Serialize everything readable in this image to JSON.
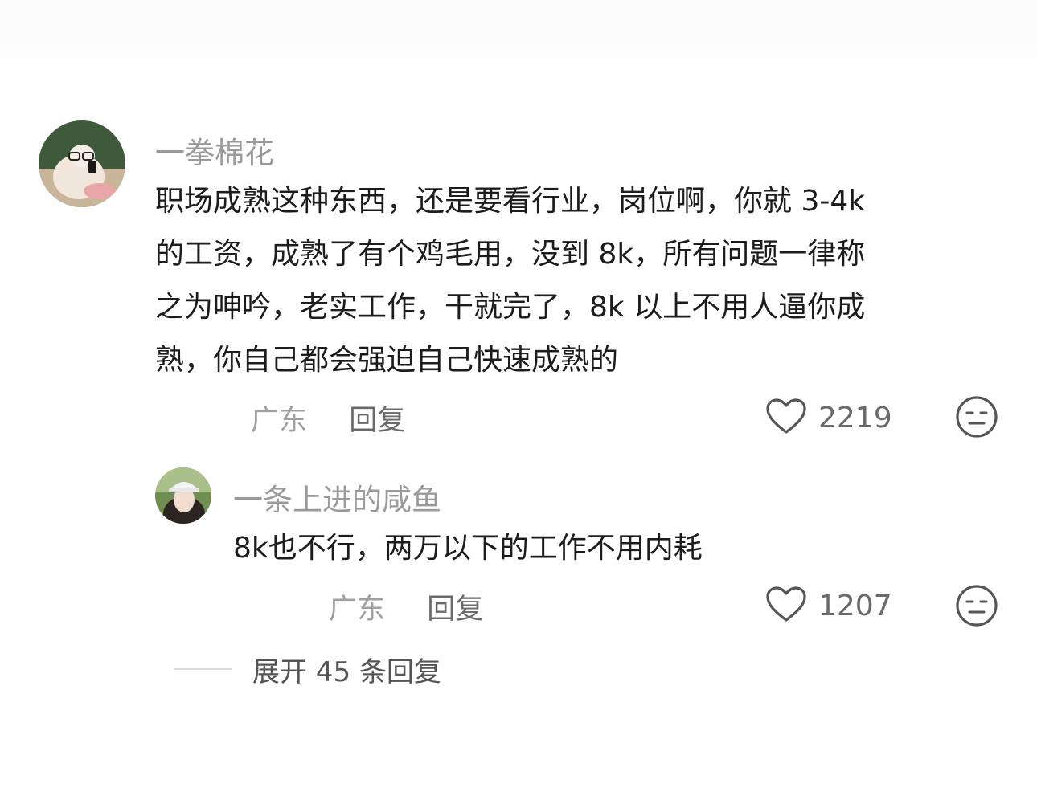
{
  "comments": [
    {
      "username": "一拳棉花",
      "lines": [
        "职场成熟这种东西，还是要看行业，岗位啊，你就 3-4k",
        "的工资，成熟了有个鸡毛用，没到 8k，所有问题一律称",
        "之为呻吟，老实工作，干就完了，8k 以上不用人逼你成",
        "熟，你自己都会强迫自己快速成熟的"
      ],
      "location": "广东",
      "reply_label": "回复",
      "likes": "2219",
      "icons": {
        "avatar": "avatar-cat-glasses",
        "like": "heart-outline-icon",
        "dislike": "meh-face-icon"
      }
    },
    {
      "username": "一条上进的咸鱼",
      "text": "8k也不行，两万以下的工作不用内耗",
      "location": "广东",
      "reply_label": "回复",
      "likes": "1207",
      "icons": {
        "avatar": "avatar-girl-hat",
        "like": "heart-outline-icon",
        "dislike": "meh-face-icon"
      }
    }
  ],
  "expand": {
    "label": "展开 45 条回复"
  },
  "colors": {
    "username": "#9a9a9a",
    "text": "#1c1c1c",
    "meta": "#a0a0a0",
    "action": "#6a6a6a"
  }
}
